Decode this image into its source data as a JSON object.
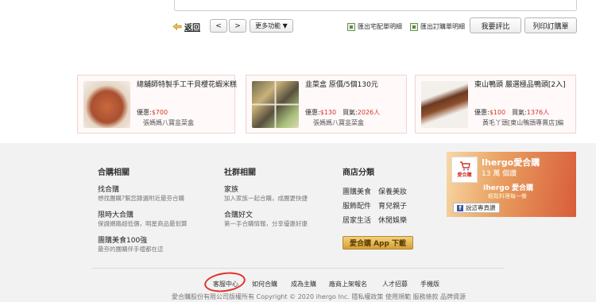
{
  "toolbar": {
    "back_label": "返回",
    "prev_label": "<",
    "next_label": ">",
    "more_label": "更多功能 ▼",
    "export_delivery_label": "匯出宅配單明細",
    "export_order_label": "匯出訂購單明細",
    "review_label": "我要評比",
    "print_label": "列印訂購單"
  },
  "products": [
    {
      "title": "總舖師特製手工干貝櫻花蝦米糕",
      "price_label": "優惠:",
      "price": "$700",
      "sold_label": "",
      "sold": "",
      "store": "張媽媽八寶韭菜盒"
    },
    {
      "title": "韭菜盒 原價/5個130元",
      "price_label": "優惠:",
      "price": "$130",
      "sold_label": "買氣:",
      "sold": "2026人",
      "store": "張媽媽八寶韭菜盒"
    },
    {
      "title": "東山鴨頭 嚴選極品鴨頭[2入]",
      "price_label": "優惠:",
      "price": "$100",
      "sold_label": "買氣:",
      "sold": "1376人",
      "store": "黃毛丫頭[東山鴨頭專賣店]編"
    }
  ],
  "footer": {
    "group_buy": {
      "title": "合購相關",
      "links": [
        {
          "title": "找合購",
          "sub": "想找團購?幫您錄選附近最夯合購"
        },
        {
          "title": "限時大合購",
          "sub": "保證網路超低價，明星商品最划算"
        },
        {
          "title": "團購美食100強",
          "sub": "最夯的團購伴手禮都在這"
        }
      ]
    },
    "community": {
      "title": "社群相關",
      "links": [
        {
          "title": "家族",
          "sub": "加入家族一起合購，成團更快捷"
        },
        {
          "title": "合購好文",
          "sub": "第一手合購情報，分享優惠好康"
        }
      ]
    },
    "categories": {
      "title": "商店分類",
      "items": [
        "團購美食",
        "保養美妝",
        "服飾配件",
        "育兒親子",
        "居家生活",
        "休閒娛樂"
      ],
      "app_label": "愛合購 App 下載"
    },
    "facebook": {
      "name": "Ihergo愛合購",
      "likes": "13 萬 個讚",
      "logo_text": "愛合購",
      "banner": "Ihergo 愛合購",
      "sub": "輕鬆料理每一餐",
      "follow_label": "說這專頁讚"
    },
    "bottom_links": [
      "客服中心",
      "如何合購",
      "成為主購",
      "廠商上架報名",
      "人才招募",
      "手機版"
    ],
    "copyright": "愛合購股份有限公司版權所有 Copyright © 2020 ihergo Inc. 隱私權政策  使用規範  服務條款  品牌資源"
  },
  "colors": {
    "price_red": "#d6332b",
    "annotation_circle": "#e0322a",
    "footer_bg": "#f2f2f2"
  }
}
